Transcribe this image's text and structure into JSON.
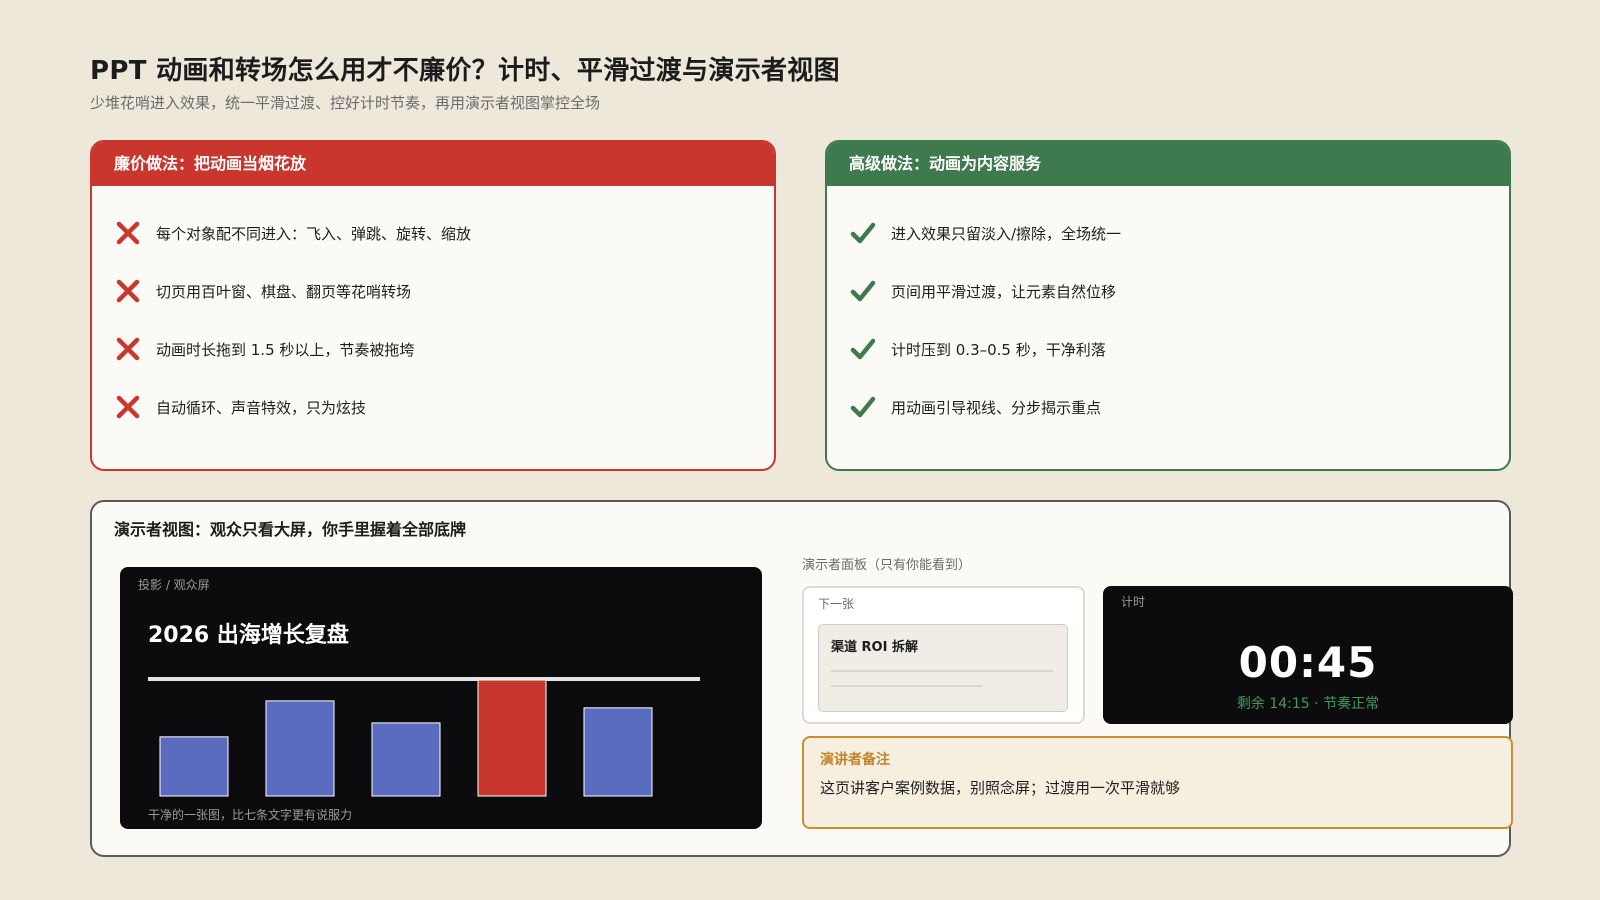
{
  "header": {
    "title": "PPT 动画和转场怎么用才不廉价？计时、平滑过渡与演示者视图",
    "subtitle": "少堆花哨进入效果，统一平滑过渡、控好计时节奏，再用演示者视图掌控全场"
  },
  "bad_card": {
    "title": "廉价做法：把动画当烟花放",
    "icon": "cross-icon",
    "color": "#c8362e",
    "items": [
      "每个对象配不同进入：飞入、弹跳、旋转、缩放",
      "切页用百叶窗、棋盘、翻页等花哨转场",
      "动画时长拖到 1.5 秒以上，节奏被拖垮",
      "自动循环、声音特效，只为炫技"
    ]
  },
  "good_card": {
    "title": "高级做法：动画为内容服务",
    "icon": "check-icon",
    "color": "#3f7a4e",
    "items": [
      "进入效果只留淡入/擦除，全场统一",
      "页间用平滑过渡，让元素自然位移",
      "计时压到 0.3–0.5 秒，干净利落",
      "用动画引导视线、分步揭示重点"
    ]
  },
  "presenter": {
    "title": "演示者视图：观众只看大屏，你手里握着全部底牌",
    "screen": {
      "label": "投影 / 观众屏",
      "slide_title": "2026 出海增长复盘",
      "caption": "干净的一张图，比七条文字更有说服力"
    },
    "panel_label": "演示者面板（只有你能看到）",
    "next": {
      "label": "下一张",
      "slide_title": "渠道 ROI 拆解"
    },
    "timer": {
      "label": "计时",
      "value": "00:45",
      "status": "剩余 14:15 · 节奏正常"
    },
    "notes": {
      "label": "演讲者备注",
      "text": "这页讲客户案例数据，别照念屏；过渡用一次平滑就够"
    }
  },
  "chart_data": {
    "type": "bar",
    "title": "",
    "xlabel": "",
    "ylabel": "",
    "ylim": [
      0,
      100
    ],
    "values": [
      51,
      82,
      63,
      100,
      76
    ],
    "highlight_index": 3,
    "colors": {
      "bar": "#5b6bc0",
      "highlight": "#c8362e",
      "axis": "#e4e4e4"
    }
  }
}
